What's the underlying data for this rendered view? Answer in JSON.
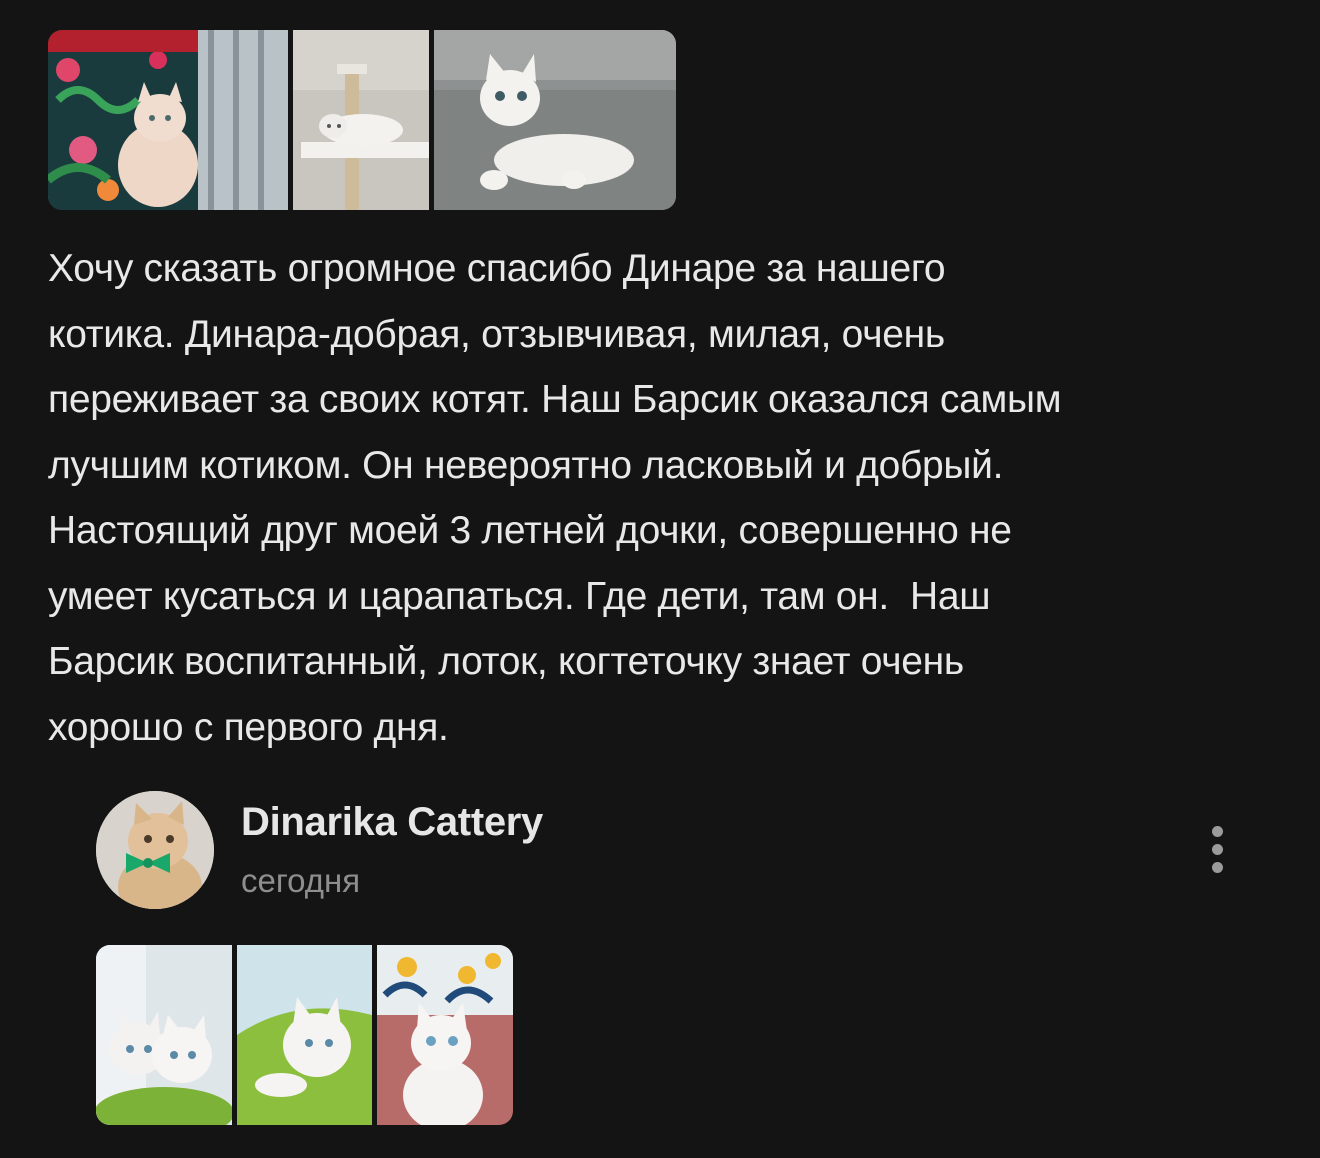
{
  "review": {
    "photos": [
      {
        "name": "review-photo-1"
      },
      {
        "name": "review-photo-2"
      },
      {
        "name": "review-photo-3"
      }
    ],
    "text": "Хочу сказать огромное спасибо Динаре за нашего\nкотика. Динара-добрая, отзывчивая, милая, очень\nпереживает за своих котят. Наш Барсик оказался самым\nлучшим котиком. Он невероятно ласковый и добрый.\nНастоящий друг моей 3 летней дочки, совершенно не\nумеет кусаться и царапаться. Где дети, там он.  Наш\nБарсик воспитанный, лоток, когтеточку знает очень\nхорошо с первого дня."
  },
  "reply": {
    "author": "Dinarika Cattery",
    "date": "сегодня",
    "more_icon": "more-vertical-icon",
    "photos": [
      {
        "name": "reply-photo-1"
      },
      {
        "name": "reply-photo-2"
      },
      {
        "name": "reply-photo-3"
      }
    ]
  },
  "colors": {
    "background": "#141414",
    "text": "#e8e8e8",
    "muted": "#8e8e8e"
  }
}
